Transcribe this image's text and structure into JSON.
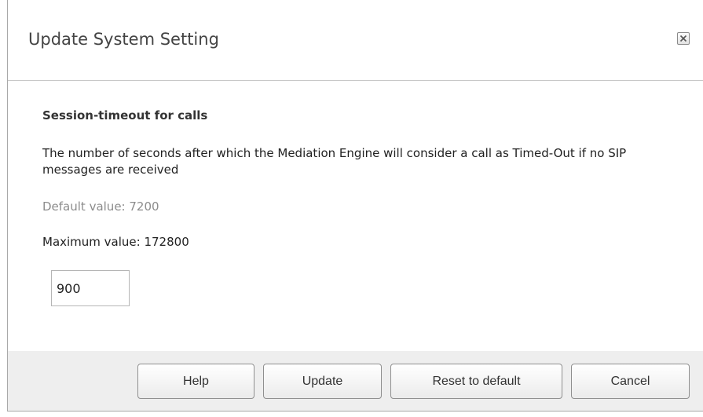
{
  "dialog": {
    "title": "Update System Setting",
    "close_icon": "close-icon"
  },
  "setting": {
    "name": "Session-timeout for calls",
    "description": "The number of seconds after which the Mediation Engine will consider a call as Timed-Out if no SIP messages are received",
    "default_value": "Default value: 7200",
    "maximum_value": "Maximum value: 172800",
    "current_value": "900"
  },
  "buttons": {
    "help": "Help",
    "update": "Update",
    "reset": "Reset to default",
    "cancel": "Cancel"
  },
  "colors": {
    "footer_background": "#eeeeee",
    "default_value_text": "#8c8c8c"
  }
}
